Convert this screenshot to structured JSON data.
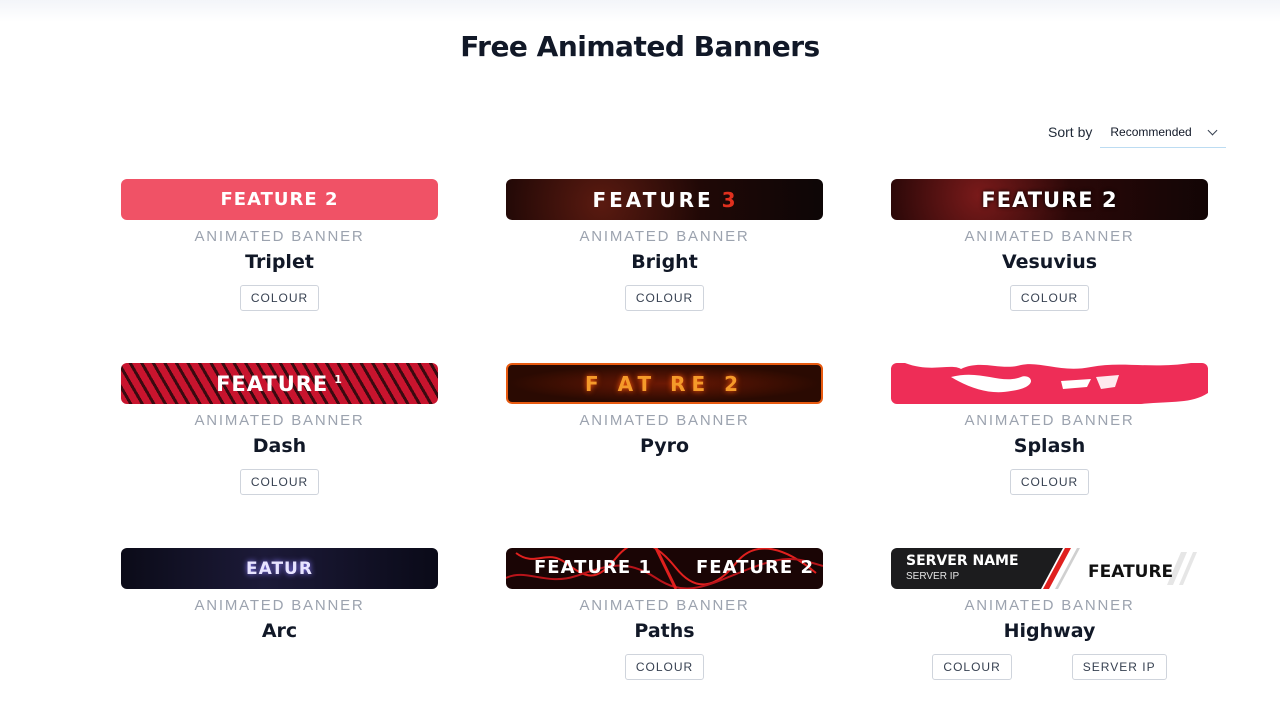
{
  "page": {
    "title": "Free Animated Banners"
  },
  "sort": {
    "label": "Sort by",
    "selected": "Recommended"
  },
  "cards": [
    {
      "banner_text": "FEATURE 2",
      "kind": "ANIMATED BANNER",
      "name": "Triplet",
      "tags": [
        "COLOUR"
      ]
    },
    {
      "banner_text": "FEATURE",
      "banner_accent": "3",
      "kind": "ANIMATED BANNER",
      "name": "Bright",
      "tags": [
        "COLOUR"
      ]
    },
    {
      "banner_text": "FEATURE 2",
      "kind": "ANIMATED BANNER",
      "name": "Vesuvius",
      "tags": [
        "COLOUR"
      ]
    },
    {
      "banner_text": "FEATURE",
      "banner_accent": "1",
      "kind": "ANIMATED BANNER",
      "name": "Dash",
      "tags": [
        "COLOUR"
      ]
    },
    {
      "banner_text": "F AT RE 2",
      "kind": "ANIMATED BANNER",
      "name": "Pyro",
      "tags": []
    },
    {
      "banner_text": "",
      "kind": "ANIMATED BANNER",
      "name": "Splash",
      "tags": [
        "COLOUR"
      ]
    },
    {
      "banner_text": "EATUR",
      "kind": "ANIMATED BANNER",
      "name": "Arc",
      "tags": []
    },
    {
      "banner_text": "FEATURE 1",
      "banner_text_2": "FEATURE 2",
      "kind": "ANIMATED BANNER",
      "name": "Paths",
      "tags": [
        "COLOUR"
      ]
    },
    {
      "banner_text": "SERVER NAME",
      "banner_sub": "SERVER IP",
      "banner_text_2": "FEATURE",
      "kind": "ANIMATED BANNER",
      "name": "Highway",
      "tags": [
        "COLOUR",
        "SERVER IP"
      ]
    }
  ],
  "colors": {
    "accent_underline": "#7cc4f2",
    "triplet": "#f05266",
    "splash": "#ee2d57",
    "muted": "#9ca3af"
  }
}
